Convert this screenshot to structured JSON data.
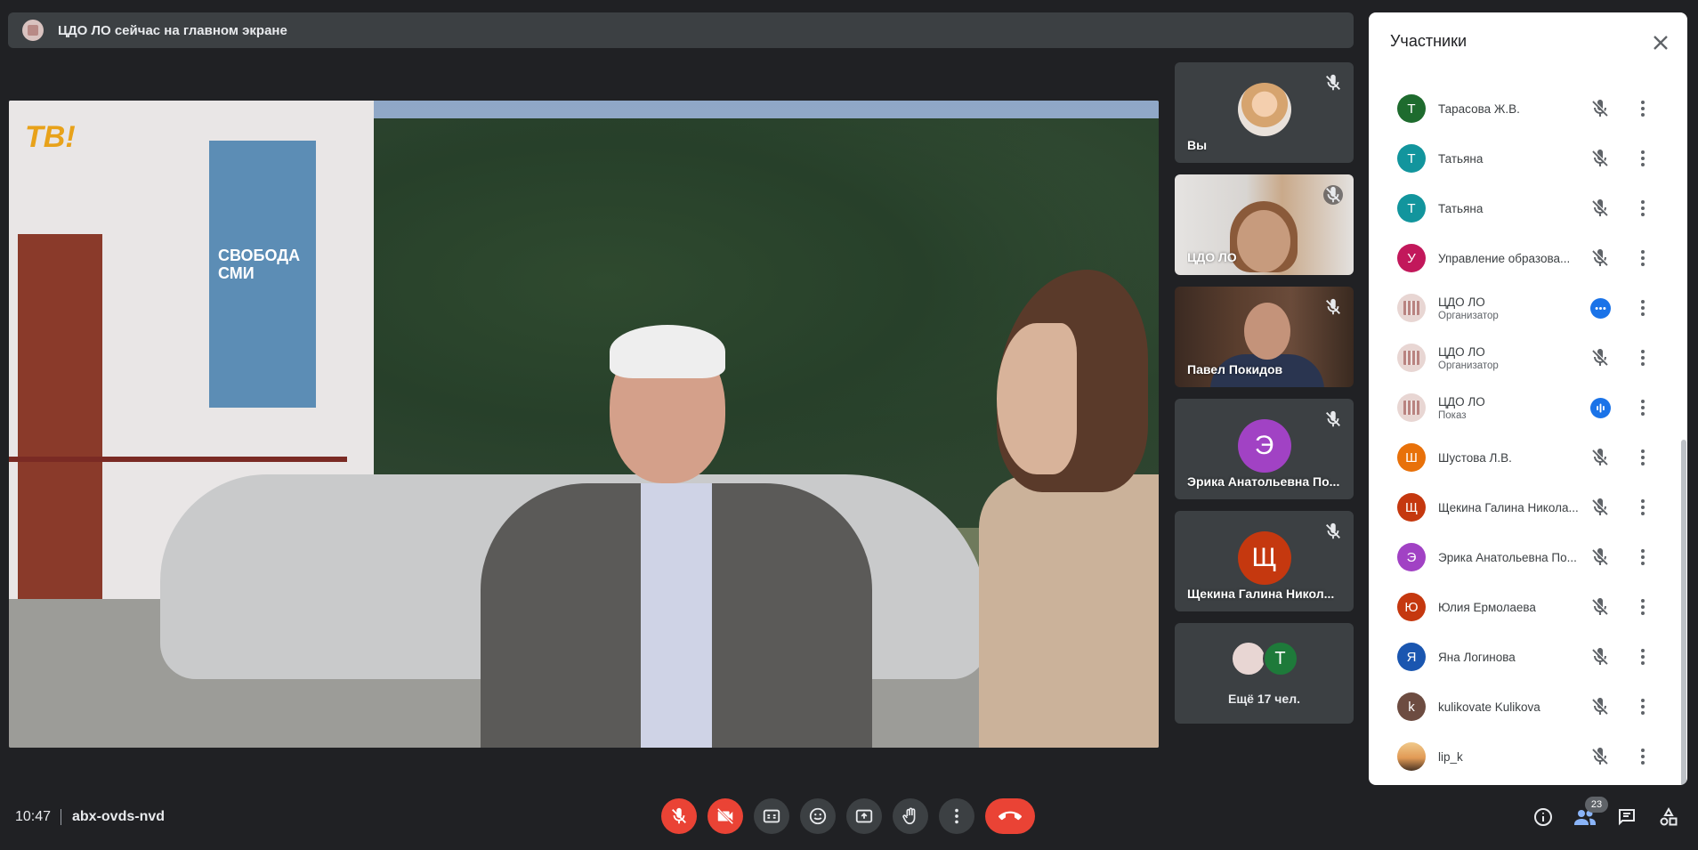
{
  "banner": {
    "text": "ЦДО ЛО сейчас на главном экране"
  },
  "tiles": {
    "you": "Вы",
    "cdo": "ЦДО ЛО",
    "pavel": "Павел Покидов",
    "erika": {
      "initial": "Э",
      "name": "Эрика Анатольевна По...",
      "color": "#a142c4"
    },
    "shchekina": {
      "initial": "Щ",
      "name": "Щекина Галина Никол...",
      "color": "#c5380f"
    },
    "more": {
      "initial": "Т",
      "label": "Ещё 17 чел.",
      "color": "#1e7a3a"
    }
  },
  "panel": {
    "title": "Участники",
    "participants": [
      {
        "initial": "Т",
        "name": "Тарасова Ж.В.",
        "role": "",
        "color": "#1e6b2e",
        "status": "muted"
      },
      {
        "initial": "Т",
        "name": "Татьяна",
        "role": "",
        "color": "#12959d",
        "status": "muted"
      },
      {
        "initial": "Т",
        "name": "Татьяна",
        "role": "",
        "color": "#12959d",
        "status": "muted"
      },
      {
        "initial": "У",
        "name": "Управление образова...",
        "role": "",
        "color": "#c2185b",
        "status": "muted"
      },
      {
        "initial": "",
        "name": "ЦДО ЛО",
        "role": "Организатор",
        "color": "logo",
        "status": "dots"
      },
      {
        "initial": "",
        "name": "ЦДО ЛО",
        "role": "Организатор",
        "color": "logo",
        "status": "muted"
      },
      {
        "initial": "",
        "name": "ЦДО ЛО",
        "role": "Показ",
        "color": "logo",
        "status": "speaking"
      },
      {
        "initial": "Ш",
        "name": "Шустова Л.В.",
        "role": "",
        "color": "#e8710a",
        "status": "muted"
      },
      {
        "initial": "Щ",
        "name": "Щекина Галина Никола...",
        "role": "",
        "color": "#c5380f",
        "status": "muted"
      },
      {
        "initial": "Э",
        "name": "Эрика Анатольевна По...",
        "role": "",
        "color": "#a142c4",
        "status": "muted"
      },
      {
        "initial": "Ю",
        "name": "Юлия Ермолаева",
        "role": "",
        "color": "#c5380f",
        "status": "muted"
      },
      {
        "initial": "Я",
        "name": "Яна Логинова",
        "role": "",
        "color": "#1a56b0",
        "status": "muted"
      },
      {
        "initial": "k",
        "name": "kulikovate Kulikova",
        "role": "",
        "color": "#6d4c41",
        "status": "muted"
      },
      {
        "initial": "",
        "name": "lip_k",
        "role": "",
        "color": "photo",
        "status": "muted"
      }
    ]
  },
  "bottombar": {
    "time": "10:47",
    "meeting_code": "abx-ovds-nvd",
    "participant_count": "23"
  },
  "video_text": {
    "tv": "TB!",
    "poster": "СВОБОДА СМИ"
  }
}
